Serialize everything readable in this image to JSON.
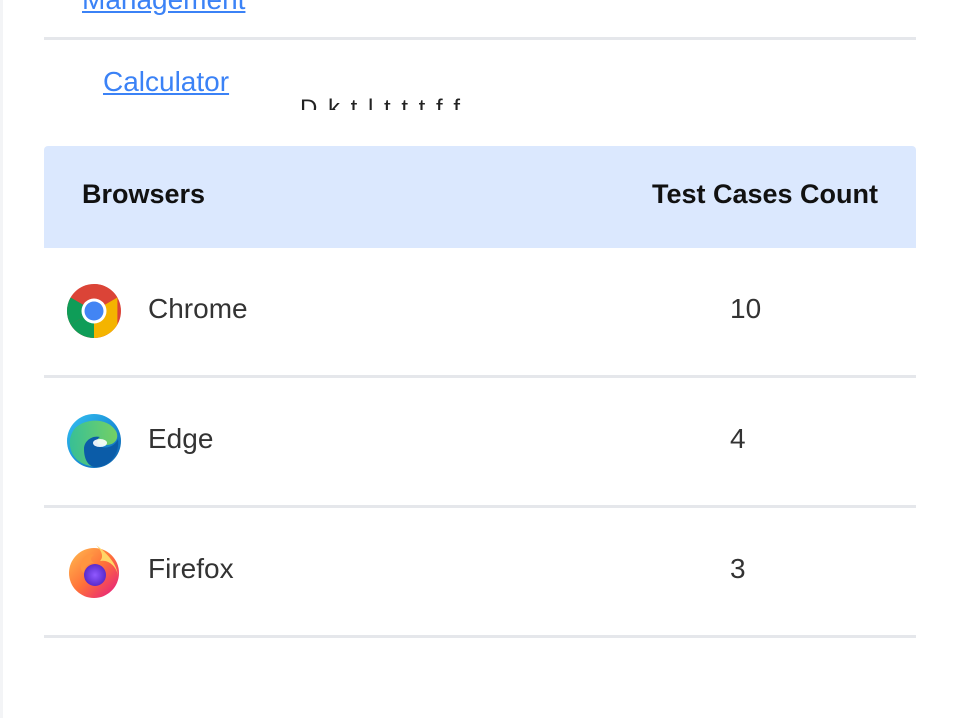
{
  "top_links": [
    {
      "label": "Management"
    },
    {
      "label": "Calculator"
    }
  ],
  "cut_text": "D  k  t    l  t  t          t          f         f",
  "table": {
    "headers": {
      "browsers": "Browsers",
      "count": "Test Cases Count"
    },
    "rows": [
      {
        "browser": "Chrome",
        "count": "10",
        "icon": "chrome-icon"
      },
      {
        "browser": "Edge",
        "count": "4",
        "icon": "edge-icon"
      },
      {
        "browser": "Firefox",
        "count": "3",
        "icon": "firefox-icon"
      }
    ]
  },
  "colors": {
    "header_bg": "#dbe8fe",
    "link": "#3b82f6",
    "divider": "#e5e7eb"
  }
}
